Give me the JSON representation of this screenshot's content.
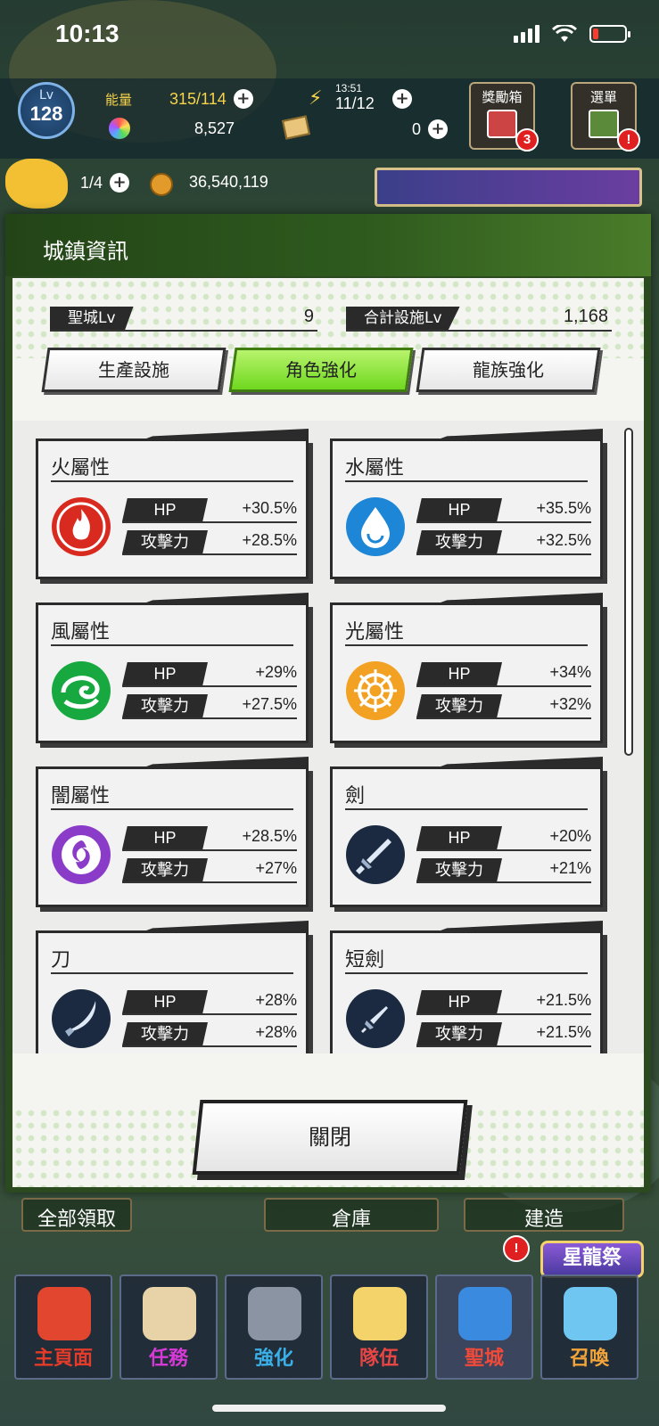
{
  "status_bar": {
    "time": "10:13"
  },
  "hud": {
    "level_label": "Lv",
    "level": "128",
    "energy_label": "能量",
    "energy": "315/114",
    "stamina_time": "13:51",
    "stamina": "11/12",
    "gems": "8,527",
    "tickets": "0",
    "medals": "1/4",
    "gold": "36,540,119",
    "reward_box_label": "獎勵箱",
    "reward_box_badge": "3",
    "menu_label": "選單",
    "menu_badge": "!"
  },
  "dialog": {
    "title": "城鎮資訊",
    "holy_city_label": "聖城Lv",
    "holy_city_value": "9",
    "total_facility_label": "合計設施Lv",
    "total_facility_value": "1,168",
    "tabs": [
      {
        "label": "生產設施",
        "active": false
      },
      {
        "label": "角色強化",
        "active": true
      },
      {
        "label": "龍族強化",
        "active": false
      }
    ],
    "hp_label": "HP",
    "atk_label": "攻擊力",
    "cards": [
      {
        "name": "火屬性",
        "icon": "fire-icon",
        "color": "#d82a1f",
        "hp": "+30.5%",
        "atk": "+28.5%"
      },
      {
        "name": "水屬性",
        "icon": "water-icon",
        "color": "#1d86d6",
        "hp": "+35.5%",
        "atk": "+32.5%"
      },
      {
        "name": "風屬性",
        "icon": "wind-icon",
        "color": "#17a93f",
        "hp": "+29%",
        "atk": "+27.5%"
      },
      {
        "name": "光屬性",
        "icon": "light-icon",
        "color": "#f2a122",
        "hp": "+34%",
        "atk": "+32%"
      },
      {
        "name": "闇屬性",
        "icon": "dark-icon",
        "color": "#8a3cc9",
        "hp": "+28.5%",
        "atk": "+27%"
      },
      {
        "name": "劍",
        "icon": "sword-icon",
        "color": "#1b2a40",
        "hp": "+20%",
        "atk": "+21%"
      },
      {
        "name": "刀",
        "icon": "blade-icon",
        "color": "#1b2a40",
        "hp": "+28%",
        "atk": "+28%"
      },
      {
        "name": "短劍",
        "icon": "dagger-icon",
        "color": "#1b2a40",
        "hp": "+21.5%",
        "atk": "+21.5%"
      }
    ],
    "close_label": "關閉"
  },
  "under_bar": {
    "claim_all": "全部領取",
    "warehouse": "倉庫",
    "build": "建造"
  },
  "nav": [
    {
      "label": "主頁面",
      "color": "#e53b2a"
    },
    {
      "label": "任務",
      "color": "#d63ad6"
    },
    {
      "label": "強化",
      "color": "#3bb0e8"
    },
    {
      "label": "隊伍",
      "color": "#e84545"
    },
    {
      "label": "聖城",
      "color": "#f04a3a"
    },
    {
      "label": "召喚",
      "color": "#f3a43a"
    }
  ],
  "event_banner": "星龍祭"
}
